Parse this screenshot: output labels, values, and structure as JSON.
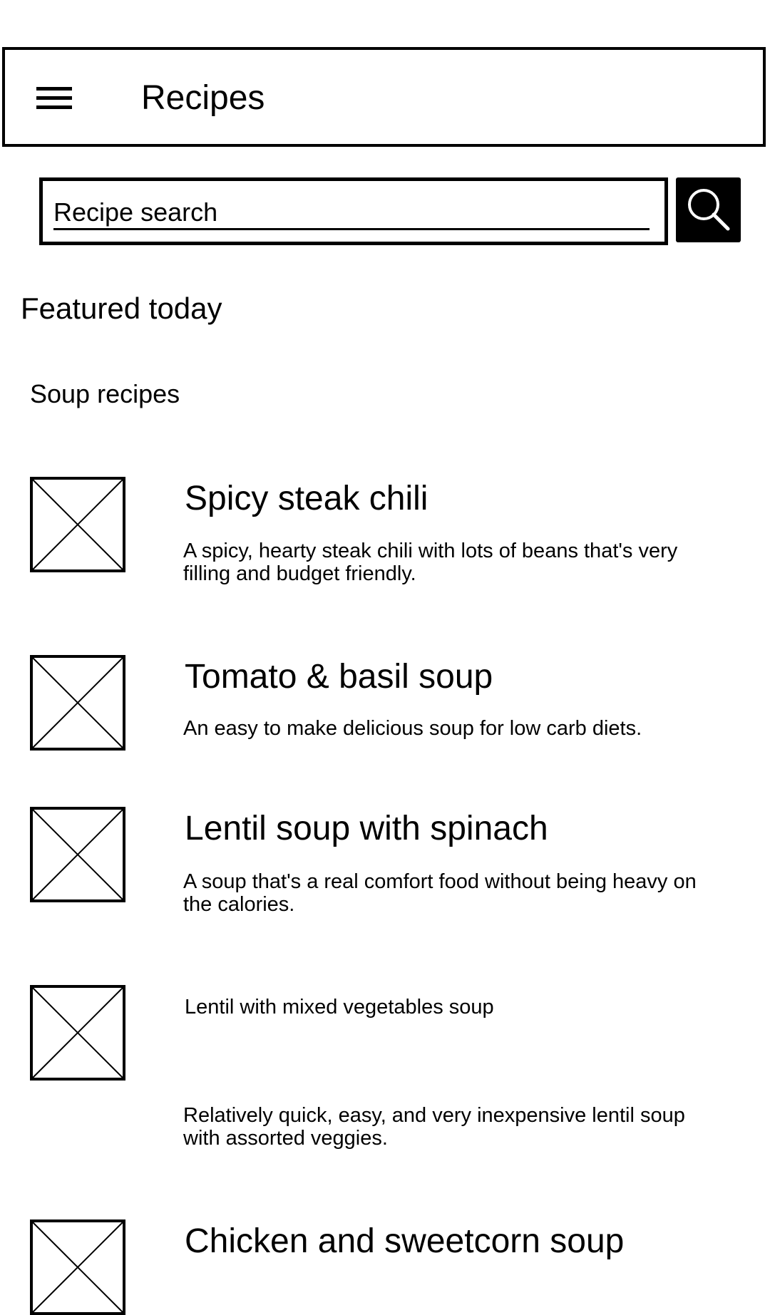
{
  "header": {
    "title": "Recipes",
    "menu_icon": "hamburger-menu-icon"
  },
  "search": {
    "placeholder": "Recipe search",
    "button_icon": "search-icon"
  },
  "featured": {
    "heading": "Featured today",
    "category": "Soup recipes"
  },
  "recipes": [
    {
      "title": "Spicy steak chili",
      "description": "A spicy, hearty steak chili with lots of beans that's very filling and budget friendly.",
      "image": "placeholder-image-icon"
    },
    {
      "title": "Tomato & basil soup",
      "description": "An easy to make delicious soup for low carb diets.",
      "image": "placeholder-image-icon"
    },
    {
      "title": "Lentil soup with spinach",
      "description": "A soup that's a real comfort food without being heavy on the calories.",
      "image": "placeholder-image-icon"
    },
    {
      "title": "Lentil with mixed vegetables soup",
      "description": "Relatively quick, easy, and very inexpensive lentil soup with assorted veggies.",
      "image": "placeholder-image-icon"
    },
    {
      "title": "Chicken and sweetcorn soup",
      "image": "placeholder-image-icon"
    }
  ]
}
